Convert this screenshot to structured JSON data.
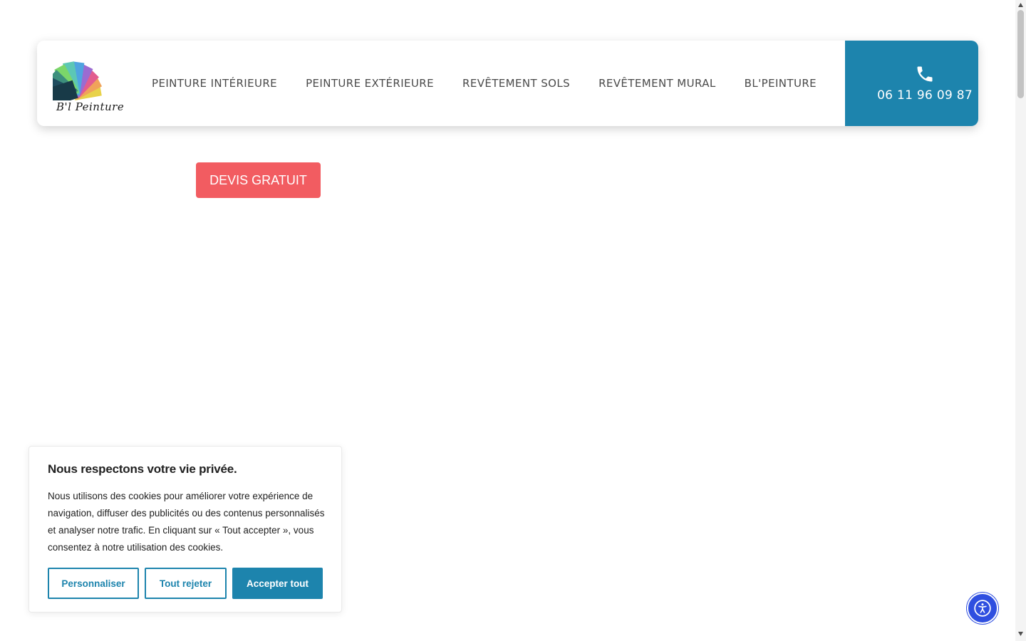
{
  "brand": {
    "logo_text": "B'l Peinture"
  },
  "nav": {
    "items": [
      {
        "label": "PEINTURE INTÉRIEURE"
      },
      {
        "label": "PEINTURE EXTÉRIEURE"
      },
      {
        "label": "REVÊTEMENT SOLS"
      },
      {
        "label": "REVÊTEMENT MURAL"
      },
      {
        "label": "BL'PEINTURE"
      }
    ]
  },
  "phone": {
    "icon": "phone-icon",
    "number": "06 11 96 09 87"
  },
  "cta": {
    "devis_label": "DEVIS GRATUIT"
  },
  "cookie_banner": {
    "title": "Nous respectons votre vie privée.",
    "text": "Nous utilisons des cookies pour améliorer votre expérience de navigation, diffuser des publicités ou des contenus personnalisés et analyser notre trafic. En cliquant sur « Tout accepter », vous consentez à notre utilisation des cookies.",
    "buttons": {
      "customize": "Personnaliser",
      "reject": "Tout rejeter",
      "accept": "Accepter tout"
    }
  },
  "accessibility": {
    "icon": "accessibility-icon"
  },
  "colors": {
    "primary": "#1d84ad",
    "cta": "#f25c61",
    "accessibility": "#2f4fe0",
    "nav_text": "#4a4a4a"
  }
}
